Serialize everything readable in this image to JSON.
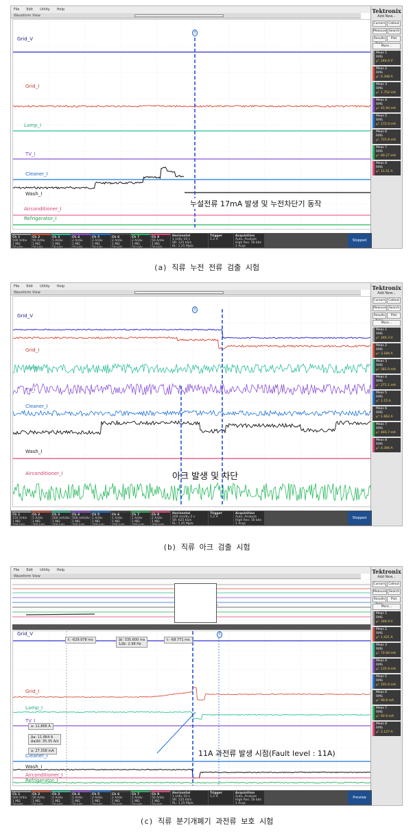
{
  "menu": [
    "File",
    "Edit",
    "Utility",
    "Help"
  ],
  "waveform_view_label": "Waveform View",
  "brand": "Tektronix",
  "add_new": "Add New...",
  "right_buttons": [
    [
      "Cursors",
      "Callout"
    ],
    [
      "Measure",
      "Search"
    ],
    [
      "Results Table",
      "Plot"
    ],
    [
      "",
      "More..."
    ]
  ],
  "stopped_label": "Stopped",
  "preview_label": "Preview",
  "colors": {
    "grid_v": "#2c2ccf",
    "grid_i": "#d9503f",
    "lamp": "#2bbf9a",
    "tv": "#8a4fd6",
    "cleaner": "#1e73d6",
    "wash": "#111111",
    "aircon": "#e0457b",
    "fridge": "#22b85a",
    "trigger_line": "#1f4fd6"
  },
  "panel_a": {
    "caption": "(a) 직류 누전 전류 검출 시험",
    "annotation": "누설전류 17mA 발생 및 누전차단기 동작",
    "labels": {
      "grid_v": "Grid_V",
      "grid_i": "Grid_I",
      "lamp": "Lamp_I",
      "tv": "TV_I",
      "cleaner": "Cleaner_I",
      "wash": "Wash_I",
      "aircon": "Airconditioner_I",
      "fridge": "Refrigerator_I"
    },
    "meas": [
      {
        "title": "Meas 1",
        "type": "RMS",
        "value": "μ': 244.6 V"
      },
      {
        "title": "Meas 2",
        "type": "RMS",
        "value": "μ': 6.348 A"
      },
      {
        "title": "Meas 3",
        "type": "RMS",
        "value": "μ': 1.752 mA"
      },
      {
        "title": "Meas 4",
        "type": "RMS",
        "value": "μ': 45.94 mA"
      },
      {
        "title": "Meas 5",
        "type": "RMS",
        "value": "μ': 172.0 mA"
      },
      {
        "title": "Meas 6",
        "type": "RMS",
        "value": "μ': 725.8 mA"
      },
      {
        "title": "Meas 7",
        "type": "RMS",
        "value": "μ': 80.27 mA"
      },
      {
        "title": "Meas 8",
        "type": "RMS",
        "value": "μ': 11.51 A"
      }
    ],
    "channels": [
      {
        "name": "Ch 1",
        "l1": "500 V/div",
        "l2": "1 MΩ",
        "l3": "50 kHz"
      },
      {
        "name": "Ch 2",
        "l1": "50 A/div",
        "l2": "1 MΩ",
        "l3": "50 kHz"
      },
      {
        "name": "Ch 3",
        "l1": "5 A/div",
        "l2": "1 MΩ",
        "l3": "50 kHz"
      },
      {
        "name": "Ch 4",
        "l1": "2 A/div",
        "l2": "1 MΩ",
        "l3": "50 kHz"
      },
      {
        "name": "Ch 5",
        "l1": "2 A/div",
        "l2": "1 MΩ",
        "l3": "50 kHz"
      },
      {
        "name": "Ch 6",
        "l1": "2 A/div",
        "l2": "1 MΩ",
        "l3": "50 kHz"
      },
      {
        "name": "Ch 7",
        "l1": "2 A/div",
        "l2": "1 MΩ",
        "l3": "50 kHz"
      },
      {
        "name": "Ch 8",
        "l1": "50 A/div",
        "l2": "1 MΩ",
        "l3": "50 kHz"
      }
    ],
    "horizontal": {
      "title": "Horizontal",
      "l1": "1 s/div   10 s",
      "l2": "SR: 125 kS/s",
      "l3": "RL: 1.25 Mpts"
    },
    "trigger": {
      "title": "Trigger",
      "l1": "1.2 A"
    },
    "acquisition": {
      "title": "Acquisition",
      "l1": "Auto, Analyze",
      "l2": "High Res: 16 bits",
      "l3": "1 Acqs"
    }
  },
  "panel_b": {
    "caption": "(b) 직류 아크 검출 시험",
    "annotation": "아크 발생 및 차단",
    "labels": {
      "grid_v": "Grid_V",
      "grid_i": "Grid_I",
      "lamp": "Lamp_I",
      "tv": "TV_I",
      "cleaner": "Cleaner_I",
      "wash": "Wash_I",
      "aircon": "Airconditioner_I"
    },
    "meas": [
      {
        "title": "Meas 1",
        "type": "RMS",
        "value": "μ': 246.3 V"
      },
      {
        "title": "Meas 2",
        "type": "RMS",
        "value": "μ': 3.184 A"
      },
      {
        "title": "Meas 3",
        "type": "RMS",
        "value": "μ': 581.0 mA"
      },
      {
        "title": "Meas 4",
        "type": "RMS",
        "value": "μ': 271.1 mA"
      },
      {
        "title": "Meas 5",
        "type": "RMS",
        "value": "μ': 1.15 A"
      },
      {
        "title": "Meas 6",
        "type": "RMS",
        "value": "μ': 1.662 A"
      },
      {
        "title": "Meas 7",
        "type": "RMS",
        "value": "μ': 403.7 mA"
      },
      {
        "title": "Meas 8",
        "type": "RMS",
        "value": "μ': 4.394 A"
      }
    ],
    "channels": [
      {
        "name": "Ch 1",
        "l1": "150 V/div",
        "l2": "1 MΩ",
        "l3": "200 kHz"
      },
      {
        "name": "Ch 2",
        "l1": "5 A/div",
        "l2": "1 MΩ",
        "l3": "200 kHz"
      },
      {
        "name": "Ch 3",
        "l1": "500 mA/div",
        "l2": "1 MΩ",
        "l3": "200 kHz"
      },
      {
        "name": "Ch 4",
        "l1": "500 mA/div",
        "l2": "1 MΩ",
        "l3": "200 kHz"
      },
      {
        "name": "Ch 5",
        "l1": "1 A/div",
        "l2": "1 MΩ",
        "l3": "200 kHz"
      },
      {
        "name": "Ch 6",
        "l1": "1 A/div",
        "l2": "1 MΩ",
        "l3": "200 kHz"
      },
      {
        "name": "Ch 7",
        "l1": "1 A/div",
        "l2": "1 MΩ",
        "l3": "200 kHz"
      },
      {
        "name": "Ch 8",
        "l1": "2 A/div",
        "l2": "1 MΩ",
        "l3": "200 kHz"
      }
    ],
    "horizontal": {
      "title": "Horizontal",
      "l1": "200 ms/div   2 s",
      "l2": "SR: 625 kS/s",
      "l3": "RL: 1.25 Mpts"
    },
    "trigger": {
      "title": "Trigger",
      "l1": "1.2 A"
    },
    "acquisition": {
      "title": "Acquisition",
      "l1": "Auto, Analyze",
      "l2": "High Res: 16 bits",
      "l3": "1 Acqs"
    }
  },
  "panel_c": {
    "caption": "(c) 직류 분기개폐기 과전류 보호 시험",
    "annotation": "11A 과전류 발생 시점(Fault level : 11A)",
    "labels": {
      "grid_v": "Grid_V",
      "grid_i": "Grid_I",
      "lamp": "Lamp_I",
      "tv": "TV_I",
      "cleaner": "Cleaner_I",
      "wash": "Wash_I",
      "aircon": "Airconditioner_I",
      "fridge": "Refrigerator_I"
    },
    "cursor_boxes": {
      "t1": "t: -629.978 ms",
      "dt": "Δt: 335.600 ms",
      "inv_dt": "1/Δt: 2.98 Hz",
      "t2": "t: -68.771 ms",
      "a": "a: 11.866 A",
      "da": "Δa: 11.864 A",
      "dadt": "Δa/Δt: 35.35 A/s",
      "b": "a: 27.358 mA"
    },
    "meas": [
      {
        "title": "Meas 1",
        "type": "RMS",
        "value": "μ': 246.9 V"
      },
      {
        "title": "Meas 2",
        "type": "RMS",
        "value": "μ': 1.421 A"
      },
      {
        "title": "Meas 3",
        "type": "RMS",
        "value": "μ': 72.04 mA"
      },
      {
        "title": "Meas 4",
        "type": "RMS",
        "value": "μ': 135.9 mA"
      },
      {
        "title": "Meas 5",
        "type": "RMS",
        "value": "μ': 191.0 mA"
      },
      {
        "title": "Meas 6",
        "type": "RMS",
        "value": "μ': 90.6 mA"
      },
      {
        "title": "Meas 7",
        "type": "RMS",
        "value": "μ': 62.6 mA"
      },
      {
        "title": "Meas 8",
        "type": "RMS",
        "value": "μ': 2.127 A"
      }
    ],
    "channels": [
      {
        "name": "Ch 1",
        "l1": "500 V/div",
        "l2": "1 MΩ",
        "l3": "50 kHz"
      },
      {
        "name": "Ch 2",
        "l1": "50 A/div",
        "l2": "1 MΩ",
        "l3": "50 kHz"
      },
      {
        "name": "Ch 3",
        "l1": "2 A/div",
        "l2": "1 MΩ",
        "l3": "50 kHz"
      },
      {
        "name": "Ch 4",
        "l1": "2 A/div",
        "l2": "1 MΩ",
        "l3": "50 kHz"
      },
      {
        "name": "Ch 5",
        "l1": "2 A/div",
        "l2": "1 MΩ",
        "l3": "50 kHz"
      },
      {
        "name": "Ch 6",
        "l1": "2 A/div",
        "l2": "1 MΩ",
        "l3": "50 kHz"
      },
      {
        "name": "Ch 7",
        "l1": "2 A/div",
        "l2": "1 MΩ",
        "l3": "50 kHz"
      },
      {
        "name": "Ch 8",
        "l1": "50 A/div",
        "l2": "1 MΩ",
        "l3": "50 kHz"
      }
    ],
    "horizontal": {
      "title": "Horizontal",
      "l1": "1 s/div   10 s",
      "l2": "SR: 125 kS/s",
      "l3": "RL: 1.25 Mpts"
    },
    "trigger": {
      "title": "Trigger",
      "l1": "1.2 A"
    },
    "acquisition": {
      "title": "Acquisition",
      "l1": "Auto, Analyze",
      "l2": "High Res: 16 bits",
      "l3": "1 Acqs"
    }
  }
}
